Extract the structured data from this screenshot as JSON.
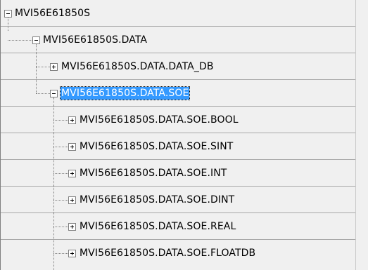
{
  "tree": {
    "root": {
      "label": "MVI56E61850S",
      "expanded": true
    },
    "data": {
      "label": "MVI56E61850S.DATA",
      "expanded": true
    },
    "data_db": {
      "label": "MVI56E61850S.DATA.DATA_DB",
      "expanded": false
    },
    "soe": {
      "label": "MVI56E61850S.DATA.SOE",
      "expanded": true,
      "selected": true
    },
    "soe_children": [
      {
        "label": "MVI56E61850S.DATA.SOE.BOOL",
        "expanded": false
      },
      {
        "label": "MVI56E61850S.DATA.SOE.SINT",
        "expanded": false
      },
      {
        "label": "MVI56E61850S.DATA.SOE.INT",
        "expanded": false
      },
      {
        "label": "MVI56E61850S.DATA.SOE.DINT",
        "expanded": false
      },
      {
        "label": "MVI56E61850S.DATA.SOE.REAL",
        "expanded": false
      },
      {
        "label": "MVI56E61850S.DATA.SOE.FLOATDB",
        "expanded": false
      }
    ]
  },
  "colors": {
    "selection": "#3399ff",
    "background": "#f0f0f0",
    "grid_line": "#a8a8a8"
  }
}
